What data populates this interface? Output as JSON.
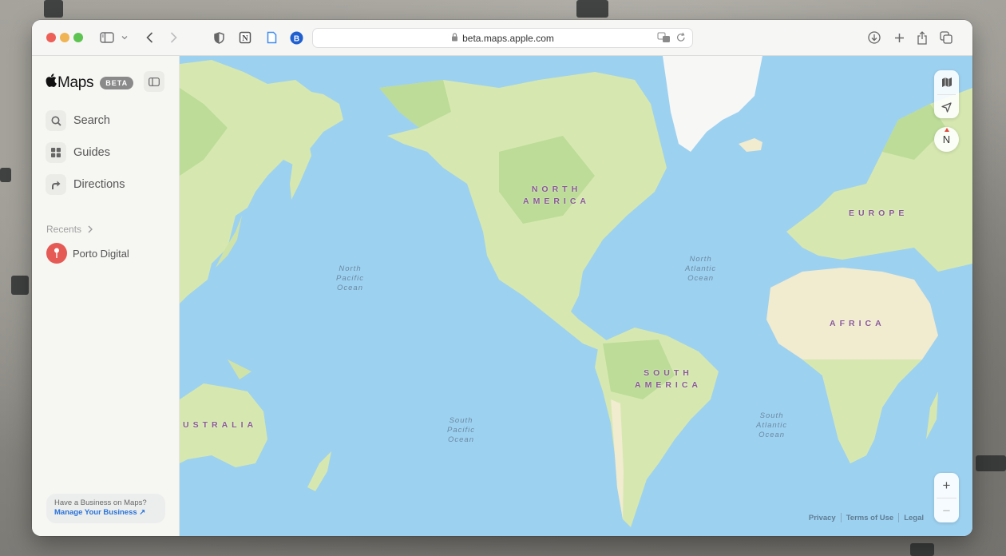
{
  "browser": {
    "url": "beta.maps.apple.com",
    "toolbar_icons": [
      "sidebar-icon",
      "chevron-down-icon",
      "back-icon",
      "forward-icon",
      "shield-icon",
      "notion-icon",
      "document-icon",
      "bitwarden-icon"
    ],
    "right_icons": [
      "download-icon",
      "new-tab-icon",
      "share-icon",
      "tabs-icon"
    ],
    "address_right_icons": [
      "translate-icon",
      "reload-icon"
    ],
    "bitwarden_letter": "B",
    "notion_letter": "N"
  },
  "sidebar": {
    "brand_apple": "",
    "brand_name": "Maps",
    "beta_badge": "BETA",
    "nav": [
      {
        "label": "Search",
        "icon": "search-icon"
      },
      {
        "label": "Guides",
        "icon": "grid-icon"
      },
      {
        "label": "Directions",
        "icon": "turn-right-arrow-icon"
      }
    ],
    "recents_label": "Recents",
    "recents": [
      {
        "label": "Porto Digital",
        "icon": "pin-icon",
        "color": "#e65a55"
      }
    ],
    "business": {
      "question": "Have a Business on Maps?",
      "link": "Manage Your Business ↗"
    }
  },
  "map": {
    "continents": [
      {
        "id": "north-america",
        "lines": [
          "NORTH",
          "AMERICA"
        ]
      },
      {
        "id": "south-america",
        "lines": [
          "SOUTH",
          "AMERICA"
        ]
      },
      {
        "id": "europe",
        "lines": [
          "EUROPE"
        ]
      },
      {
        "id": "africa",
        "lines": [
          "AFRICA"
        ]
      },
      {
        "id": "australia",
        "lines": [
          "USTRALIA"
        ]
      }
    ],
    "oceans": [
      {
        "id": "north-pacific",
        "lines": [
          "North",
          "Pacific",
          "Ocean"
        ]
      },
      {
        "id": "north-atlantic",
        "lines": [
          "North",
          "Atlantic",
          "Ocean"
        ]
      },
      {
        "id": "south-pacific",
        "lines": [
          "South",
          "Pacific",
          "Ocean"
        ]
      },
      {
        "id": "south-atlantic",
        "lines": [
          "South",
          "Atlantic",
          "Ocean"
        ]
      }
    ],
    "compass_label": "N",
    "zoom_in": "+",
    "zoom_out": "−",
    "footer_links": [
      "Privacy",
      "Terms of Use",
      "Legal"
    ],
    "colors": {
      "water": "#9dd1f0",
      "land": "#d6e8b0",
      "forest": "#bcdc98",
      "desert": "#f1ebd0",
      "ice": "#f7f7f6",
      "label": "#8a5a93"
    }
  }
}
